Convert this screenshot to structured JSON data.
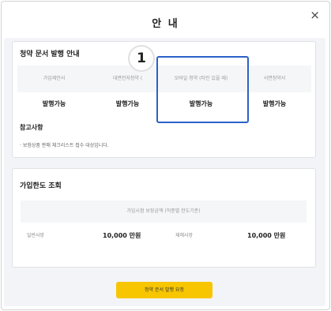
{
  "modal": {
    "title": "안 내",
    "close_symbol": "×"
  },
  "issue": {
    "heading": "청약 문서 발행 안내",
    "columns": [
      "가입제안서",
      "대면전자청약 (",
      "모바일 청약 (타인 있을 때)",
      "서면청약서"
    ],
    "statuses": [
      "발행가능",
      "발행가능",
      "발행가능",
      "발행가능"
    ],
    "step_badge": "1"
  },
  "note": {
    "title": "참고사항",
    "text": "· 보험상품 판매 체크리스트 접수 대상입니다."
  },
  "limit": {
    "heading": "가입한도 조회",
    "table_header": "가입시점 보장금액 (직종별 한도기준)",
    "rows": [
      {
        "label": "일반사망",
        "value": "10,000 만원"
      },
      {
        "label": "재해사망",
        "value": "10,000 만원"
      }
    ]
  },
  "action_button": {
    "label": "청약 문서 발행 요청"
  },
  "colors": {
    "accent_yellow": "#f7c600",
    "highlight_blue": "#2b62c8",
    "background_gray": "#f3f4f7"
  }
}
